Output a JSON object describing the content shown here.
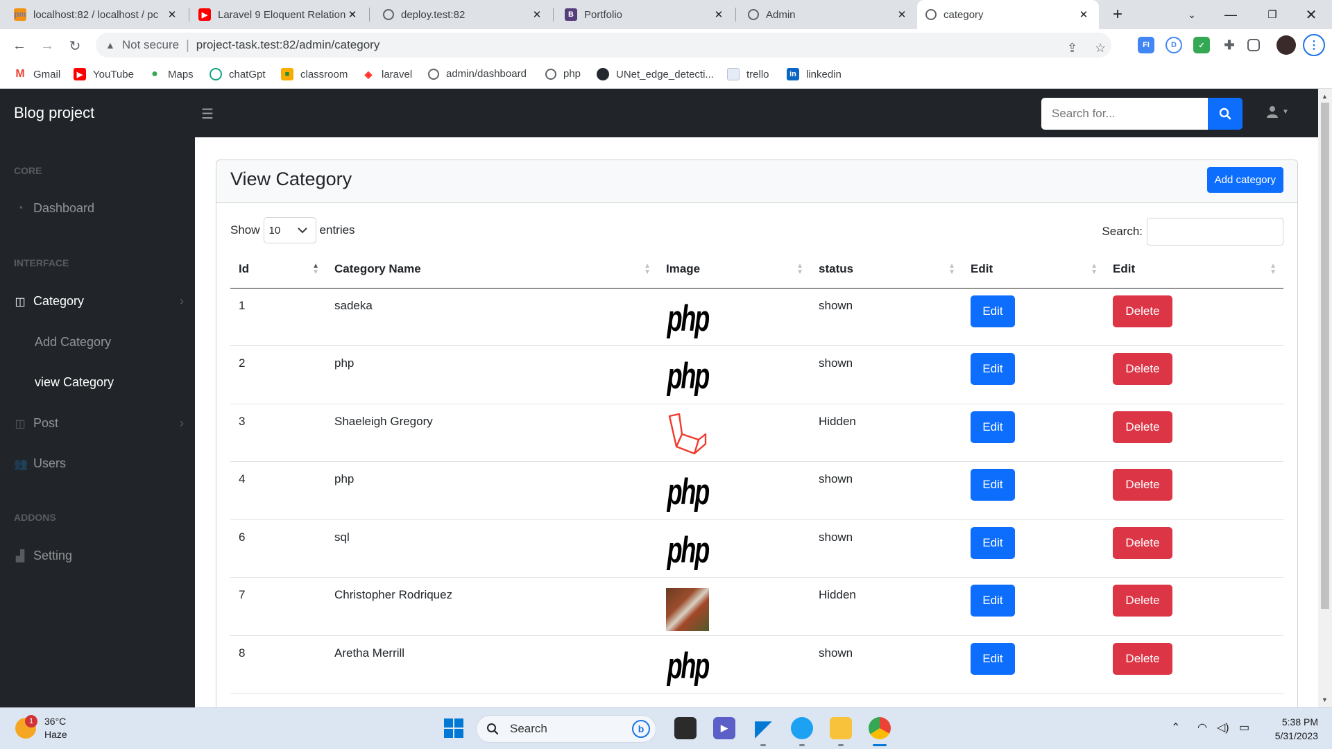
{
  "browser": {
    "tabs": [
      {
        "title": "localhost:82 / localhost / pc",
        "icon": "phpmyadmin-icon"
      },
      {
        "title": "Laravel 9 Eloquent Relation",
        "icon": "youtube-icon"
      },
      {
        "title": "deploy.test:82",
        "icon": "globe-icon"
      },
      {
        "title": "Portfolio",
        "icon": "bootstrap-icon"
      },
      {
        "title": "Admin",
        "icon": "globe-icon"
      },
      {
        "title": "category",
        "icon": "globe-icon",
        "active": true
      }
    ],
    "security_label": "Not secure",
    "url": "project-task.test:82/admin/category",
    "bookmarks": [
      "Gmail",
      "YouTube",
      "Maps",
      "chatGpt",
      "classroom",
      "laravel",
      "admin/dashboard",
      "php",
      "UNet_edge_detecti...",
      "trello",
      "linkedin"
    ]
  },
  "topnav": {
    "brand": "Blog project",
    "search_placeholder": "Search for..."
  },
  "sidebar": {
    "headings": [
      "Core",
      "Interface",
      "Addons"
    ],
    "items": {
      "dashboard": "Dashboard",
      "category": "Category",
      "add_category": "Add Category",
      "view_category": "view Category",
      "post": "Post",
      "users": "Users",
      "setting": "Setting"
    }
  },
  "main": {
    "title": "View Category",
    "add_button": "Add category",
    "show_label": "Show",
    "entries_value": "10",
    "entries_label": "entries",
    "search_label": "Search:",
    "columns": [
      "Id",
      "Category Name",
      "Image",
      "status",
      "Edit",
      "Edit"
    ],
    "edit_label": "Edit",
    "delete_label": "Delete",
    "rows": [
      {
        "id": "1",
        "name": "sadeka",
        "image": "php-logo",
        "status": "shown"
      },
      {
        "id": "2",
        "name": "php",
        "image": "php-logo",
        "status": "shown"
      },
      {
        "id": "3",
        "name": "Shaeleigh Gregory",
        "image": "laravel-logo",
        "status": "Hidden"
      },
      {
        "id": "4",
        "name": "php",
        "image": "php-logo",
        "status": "shown"
      },
      {
        "id": "6",
        "name": "sql",
        "image": "php-logo",
        "status": "shown"
      },
      {
        "id": "7",
        "name": "Christopher Rodriquez",
        "image": "photo",
        "status": "Hidden"
      },
      {
        "id": "8",
        "name": "Aretha Merrill",
        "image": "php-logo",
        "status": "shown"
      }
    ]
  },
  "taskbar": {
    "temperature": "36°C",
    "weather": "Haze",
    "weather_badge": "1",
    "search_label": "Search",
    "time": "5:38 PM",
    "date": "5/31/2023"
  },
  "colors": {
    "primary": "#0d6efd",
    "danger": "#dc3545",
    "dark": "#212529"
  }
}
